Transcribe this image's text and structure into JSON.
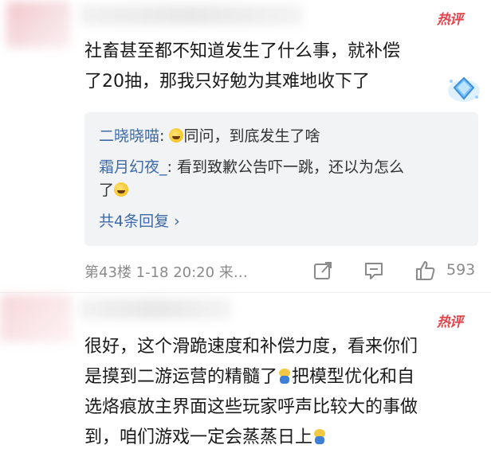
{
  "comment1": {
    "hot_label": "热评",
    "text_line1": "社畜甚至都不知道发生了什么事，就补偿",
    "text_line2": "了20抽，那我只好勉为其难地收下了",
    "replies": [
      {
        "name": "二晓晓喵",
        "sep": ": ",
        "text": "同问，到底发生了啥"
      },
      {
        "name": "霜月幻夜_",
        "sep": ": ",
        "text_line1": "看到致歉公告吓一跳，还以为怎么",
        "text_line2": "了"
      }
    ],
    "more_replies": "共4条回复 ›",
    "meta": "第43楼  1-18 20:20  来…",
    "like_count": "593"
  },
  "comment2": {
    "hot_label": "热评",
    "text_line1": "很好，这个滑跪速度和补偿力度，看来你们",
    "text_line2a": "是摸到二游运营的精髓了",
    "text_line2b": "把模型优化和自",
    "text_line3": "选烙痕放主界面这些玩家呼声比较大的事做",
    "text_line4": "到，咱们游戏一定会蒸蒸日上"
  },
  "colors": {
    "hot": "#e0454b",
    "reply_name": "#3d6aa7",
    "meta": "#8a8a8a",
    "reply_bg": "#f2f3f5"
  },
  "icons": [
    "share-icon",
    "comment-icon",
    "like-icon",
    "diamond-badge-icon",
    "laugh-emoji",
    "bear-emoji"
  ]
}
